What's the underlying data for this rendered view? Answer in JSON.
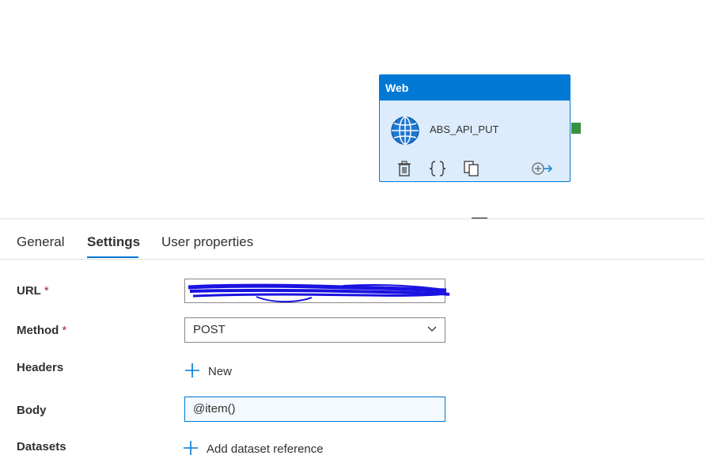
{
  "activity": {
    "type_label": "Web",
    "name": "ABS_API_PUT",
    "icon": "globe-icon",
    "actions": [
      "delete-icon",
      "code-icon",
      "copy-icon",
      "add-output-icon"
    ]
  },
  "tabs": [
    {
      "label": "General",
      "active": false
    },
    {
      "label": "Settings",
      "active": true
    },
    {
      "label": "User properties",
      "active": false
    }
  ],
  "form": {
    "url": {
      "label": "URL",
      "required": "*",
      "value": ""
    },
    "method": {
      "label": "Method",
      "required": "*",
      "value": "POST"
    },
    "headers": {
      "label": "Headers",
      "add_label": "New"
    },
    "body": {
      "label": "Body",
      "value": "@item()"
    },
    "datasets": {
      "label": "Datasets",
      "add_label": "Add dataset reference"
    }
  },
  "colors": {
    "accent": "#0078d4",
    "activity_bg": "#dcecfc",
    "connector": "#3a9140",
    "required": "#a4262c",
    "redaction": "#1a12e0"
  }
}
